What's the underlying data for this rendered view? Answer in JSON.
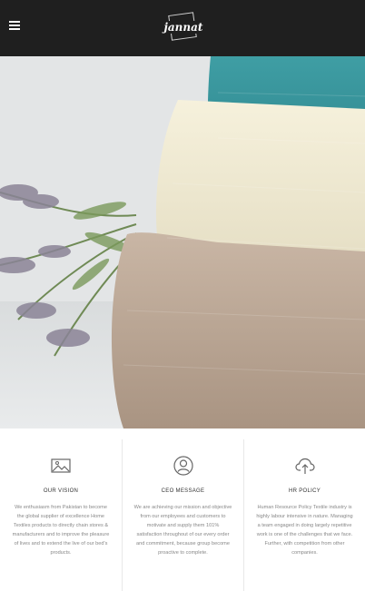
{
  "header": {
    "menu_icon": "hamburger-menu-icon",
    "logo_text": "jannat"
  },
  "hero": {
    "image_description_icon": "towels-photo"
  },
  "features": [
    {
      "icon": "image-icon",
      "title": "OUR VISION",
      "text": "We enthusiasm from Pakistan to become the global supplier of excellence Home Textiles products to directly chain stores & manufacturers and to improve the pleasure of lives and to extend the live of our bed's products."
    },
    {
      "icon": "user-circle-icon",
      "title": "CEO MESSAGE",
      "text": "We are achieving our mission and objective from our employees and customers to motivate and supply them 101% satisfaction throughout of our every order and commitment, because group become proactive to complete."
    },
    {
      "icon": "cloud-upload-icon",
      "title": "HR POLICY",
      "text": "Human Resource Policy Textile industry is highly labour intensive in nature. Managing a team engaged in doing largely repetitive work is one of the challenges that we face. Further, with competition from other companies."
    }
  ]
}
